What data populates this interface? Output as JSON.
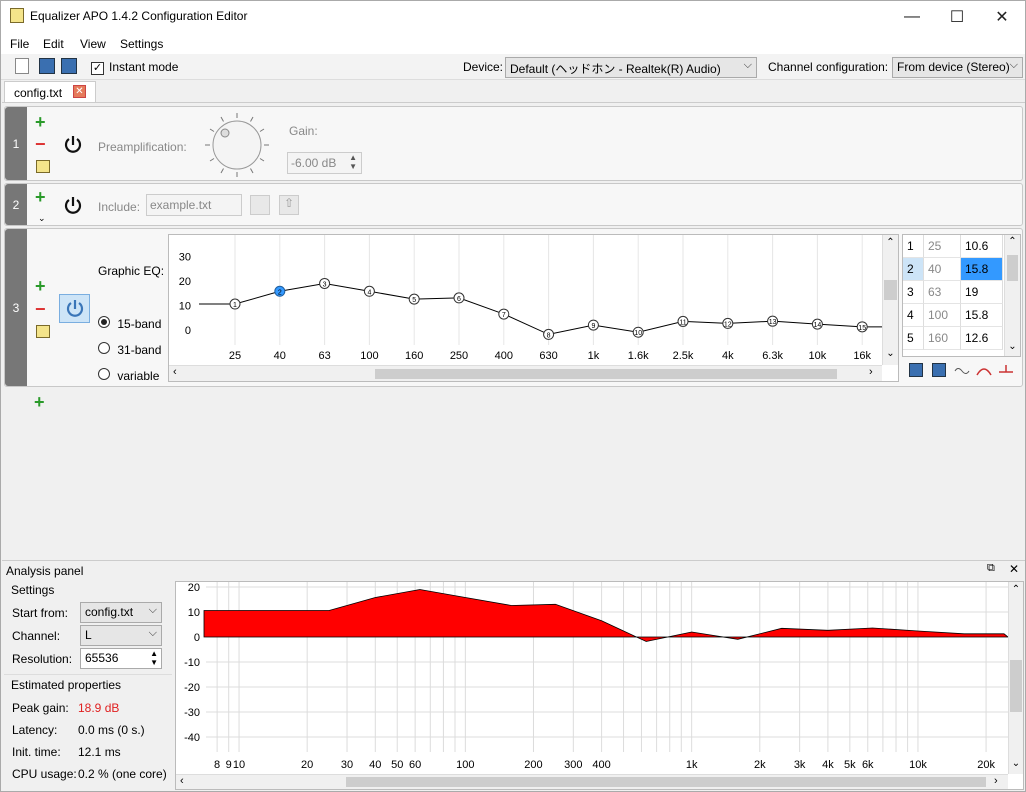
{
  "window": {
    "title": "Equalizer APO 1.4.2 Configuration Editor",
    "min": "—",
    "max": "☐",
    "close": "✕"
  },
  "menu": [
    "File",
    "Edit",
    "View",
    "Settings"
  ],
  "toolbar": {
    "instant_mode": "Instant mode",
    "device_label": "Device:",
    "device_value": "Default (ヘッドホン - Realtek(R) Audio)",
    "channel_label": "Channel configuration:",
    "channel_value": "From device (Stereo)"
  },
  "tab": {
    "label": "config.txt",
    "close": "✕"
  },
  "filters": [
    {
      "num": "1",
      "preamp_label": "Preamplification:",
      "gain_label": "Gain:",
      "gain_value": "-6.00 dB"
    },
    {
      "num": "2",
      "include_label": "Include:",
      "include_placeholder": "example.txt"
    },
    {
      "num": "3",
      "geq_label": "Graphic EQ:",
      "modes": [
        "15-band",
        "31-band",
        "variable"
      ],
      "selected_mode": "15-band"
    }
  ],
  "geq": {
    "y_ticks": [
      "30",
      "20",
      "10",
      "0"
    ],
    "x_labels": [
      "25",
      "40",
      "63",
      "100",
      "160",
      "250",
      "400",
      "630",
      "1k",
      "1.6k",
      "2.5k",
      "4k",
      "6.3k",
      "10k",
      "16k"
    ],
    "gains": [
      10.6,
      15.8,
      19,
      15.8,
      12.6,
      13.1,
      6.5,
      -1.8,
      2,
      -0.9,
      3.5,
      2.7,
      3.6,
      2.4,
      1.3
    ],
    "selected_band": 2
  },
  "band_table": [
    {
      "n": "1",
      "freq": "25",
      "gain": "10.6"
    },
    {
      "n": "2",
      "freq": "40",
      "gain": "15.8"
    },
    {
      "n": "3",
      "freq": "63",
      "gain": "19"
    },
    {
      "n": "4",
      "freq": "100",
      "gain": "15.8"
    },
    {
      "n": "5",
      "freq": "160",
      "gain": "12.6"
    }
  ],
  "analysis": {
    "title": "Analysis panel",
    "settings_title": "Settings",
    "start_from_label": "Start from:",
    "start_from_value": "config.txt",
    "channel_label": "Channel:",
    "channel_value": "L",
    "resolution_label": "Resolution:",
    "resolution_value": "65536",
    "est_title": "Estimated properties",
    "peak_label": "Peak gain:",
    "peak_value": "18.9 dB",
    "latency_label": "Latency:",
    "latency_value": "0.0 ms (0 s.)",
    "init_label": "Init. time:",
    "init_value": "12.1 ms",
    "cpu_label": "CPU usage:",
    "cpu_value": "0.2 % (one core)",
    "y_ticks": [
      "20",
      "10",
      "0",
      "-10",
      "-20",
      "-30",
      "-40"
    ],
    "x_labels": [
      "8",
      "9",
      "10",
      "20",
      "30",
      "40",
      "50",
      "60",
      "100",
      "200",
      "300",
      "400",
      "1k",
      "2k",
      "3k",
      "4k",
      "5k",
      "6k",
      "10k",
      "20k"
    ],
    "fill_color": "#ff0000"
  }
}
